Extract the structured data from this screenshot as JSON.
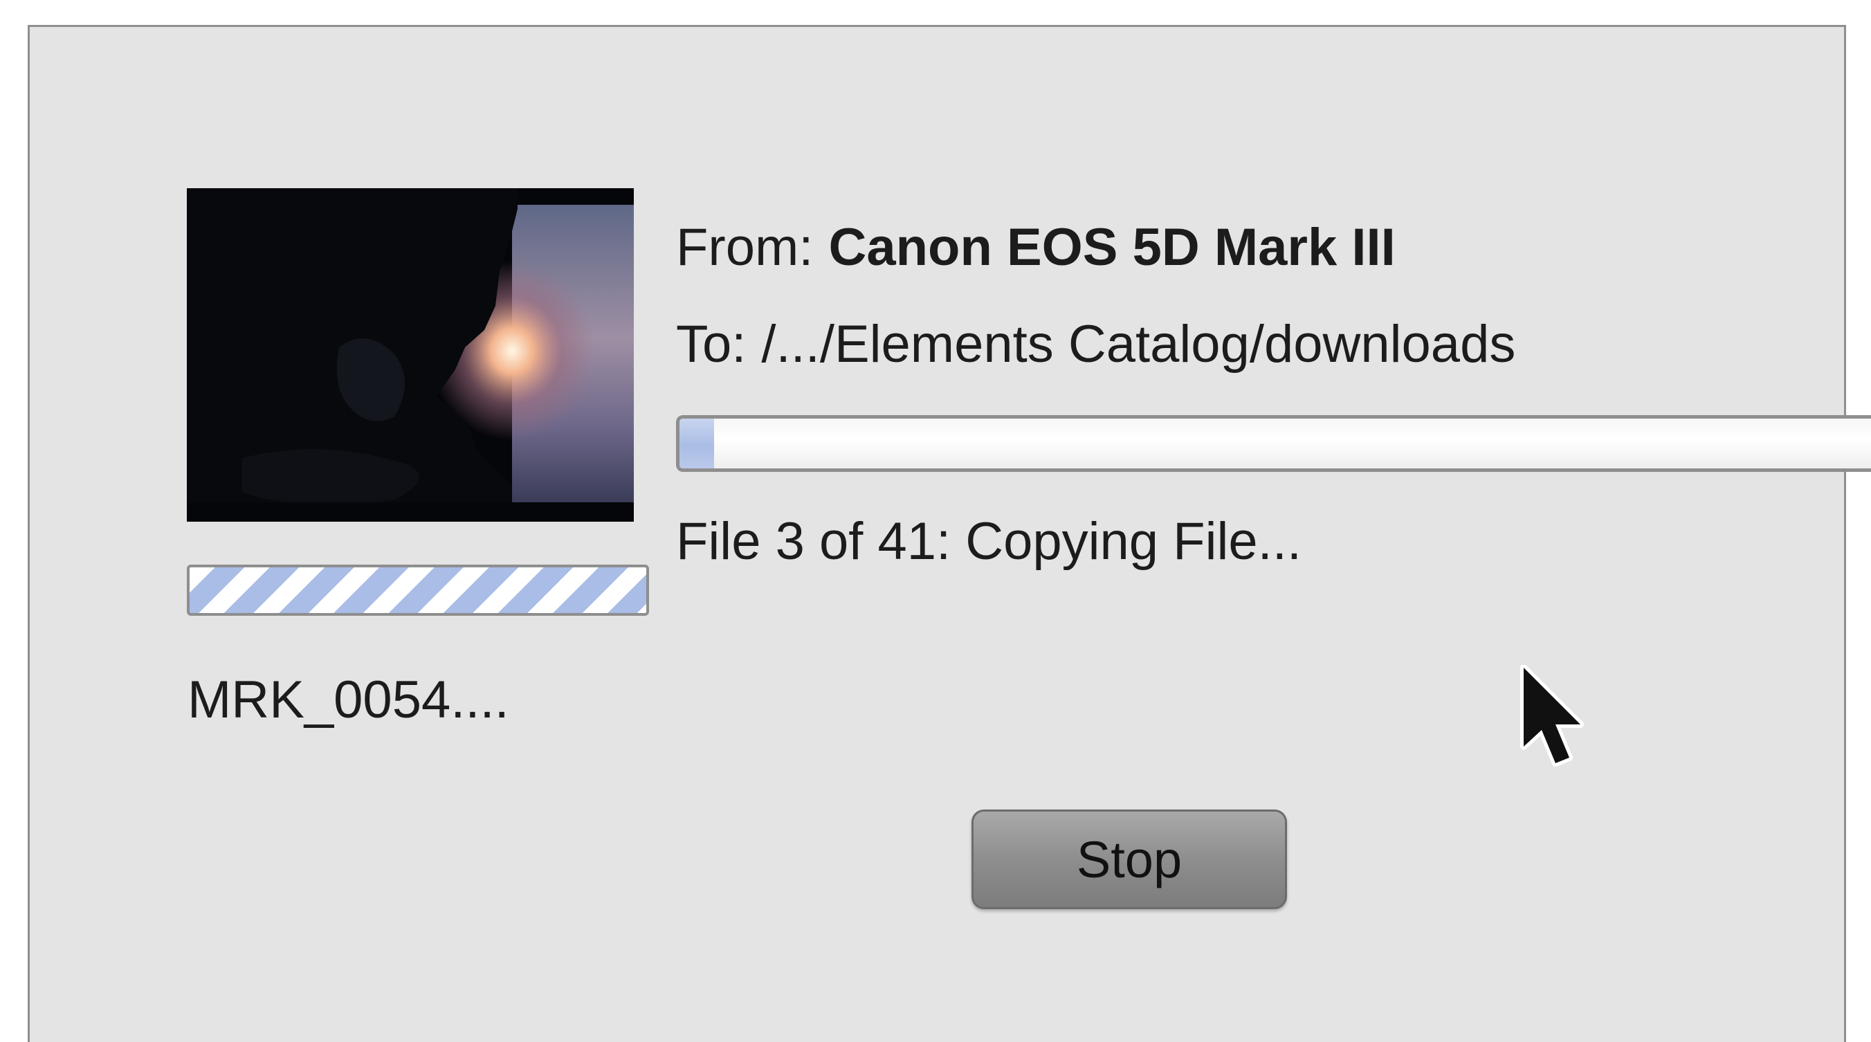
{
  "import_dialog": {
    "thumbnail": {
      "description_icon": "photo-thumbnail"
    },
    "current_file": {
      "name": "MRK_0054....",
      "progress_style": "indeterminate-striped"
    },
    "from_label": "From:",
    "from_value": "Canon EOS 5D Mark III",
    "to_label": "To:",
    "to_value": "/.../Elements Catalog/downloads",
    "overall_progress": {
      "current": 3,
      "total": 41,
      "fraction": 0.029
    },
    "status_text": "File 3 of 41: Copying File...",
    "stop_button_label": "Stop"
  },
  "colors": {
    "dialog_background": "#e4e4e4",
    "progress_fill": "#aabde6",
    "button_gray": "#8e8e8e"
  },
  "cursor_icon": "arrow-pointer-icon"
}
